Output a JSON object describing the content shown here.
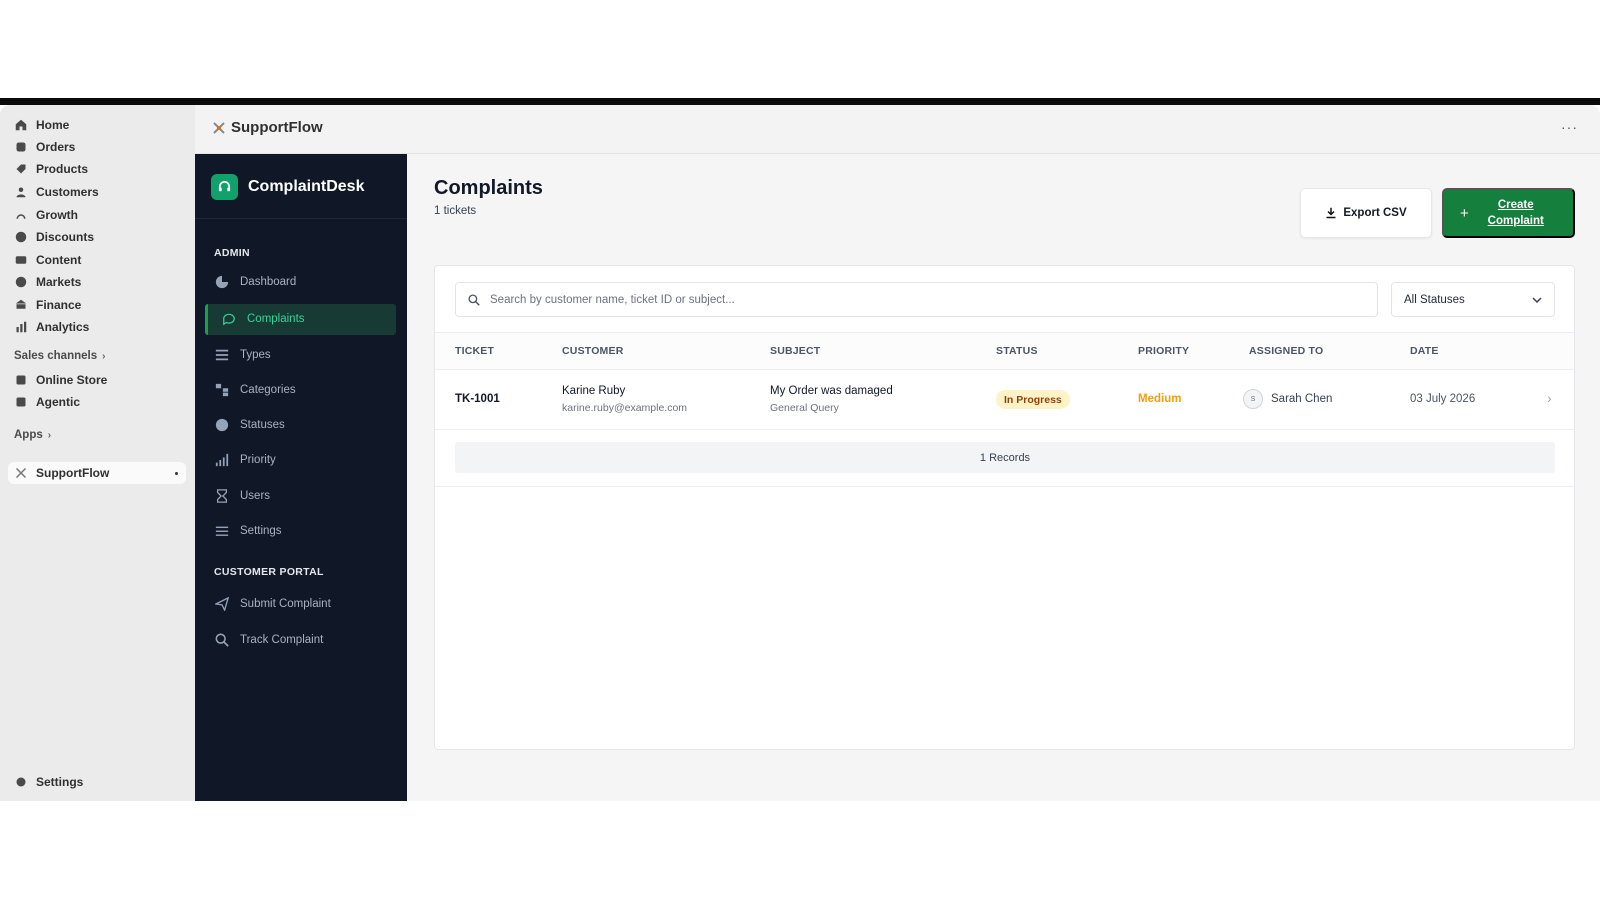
{
  "shop_nav": {
    "items": [
      {
        "label": "Home",
        "icon": "home-icon"
      },
      {
        "label": "Orders",
        "icon": "orders-icon"
      },
      {
        "label": "Products",
        "icon": "tag-icon"
      },
      {
        "label": "Customers",
        "icon": "person-icon"
      },
      {
        "label": "Growth",
        "icon": "growth-icon"
      },
      {
        "label": "Discounts",
        "icon": "discount-icon"
      },
      {
        "label": "Content",
        "icon": "content-icon"
      },
      {
        "label": "Markets",
        "icon": "globe-icon"
      },
      {
        "label": "Finance",
        "icon": "bank-icon"
      },
      {
        "label": "Analytics",
        "icon": "bar-chart-icon"
      }
    ],
    "sales_channels_heading": "Sales channels",
    "sales_channels": [
      {
        "label": "Online Store",
        "icon": "store-icon"
      },
      {
        "label": "Agentic",
        "icon": "agentic-icon"
      }
    ],
    "apps_heading": "Apps",
    "apps": [
      {
        "label": "SupportFlow",
        "icon": "supportflow-icon"
      }
    ],
    "settings_label": "Settings"
  },
  "app_header": {
    "title": "SupportFlow",
    "more": "···"
  },
  "sidebar": {
    "brand": "ComplaintDesk",
    "admin_heading": "ADMIN",
    "admin_items": [
      {
        "label": "Dashboard",
        "icon": "pie-chart-icon"
      },
      {
        "label": "Complaints",
        "icon": "chat-bubble-icon",
        "active": true
      },
      {
        "label": "Types",
        "icon": "list-icon"
      },
      {
        "label": "Categories",
        "icon": "sitemap-icon"
      },
      {
        "label": "Statuses",
        "icon": "check-circle-icon"
      },
      {
        "label": "Priority",
        "icon": "signal-bars-icon"
      },
      {
        "label": "Users",
        "icon": "hourglass-icon"
      },
      {
        "label": "Settings",
        "icon": "sliders-icon"
      }
    ],
    "portal_heading": "CUSTOMER PORTAL",
    "portal_items": [
      {
        "label": "Submit Complaint",
        "icon": "paper-plane-icon"
      },
      {
        "label": "Track Complaint",
        "icon": "search-icon"
      }
    ]
  },
  "main": {
    "title": "Complaints",
    "subtitle": "1 tickets",
    "export_label": "Export CSV",
    "create_label": "Create Complaint",
    "search_placeholder": "Search by customer name, ticket ID or subject...",
    "status_filter": "All Statuses",
    "columns": [
      "TICKET",
      "CUSTOMER",
      "SUBJECT",
      "STATUS",
      "PRIORITY",
      "ASSIGNED TO",
      "DATE"
    ],
    "rows": [
      {
        "ticket": "TK-1001",
        "customer_name": "Karine Ruby",
        "customer_email": "karine.ruby@example.com",
        "subject": "My Order was damaged",
        "subject_type": "General Query",
        "status": "In Progress",
        "priority": "Medium",
        "assignee_initial": "S",
        "assignee": "Sarah Chen",
        "date": "03 July 2026"
      }
    ],
    "records_label": "1 Records"
  },
  "colors": {
    "accent_green": "#15803d",
    "sidebar_bg": "#101828",
    "status_bg": "#fef3c7",
    "priority_medium": "#f59e0b"
  }
}
